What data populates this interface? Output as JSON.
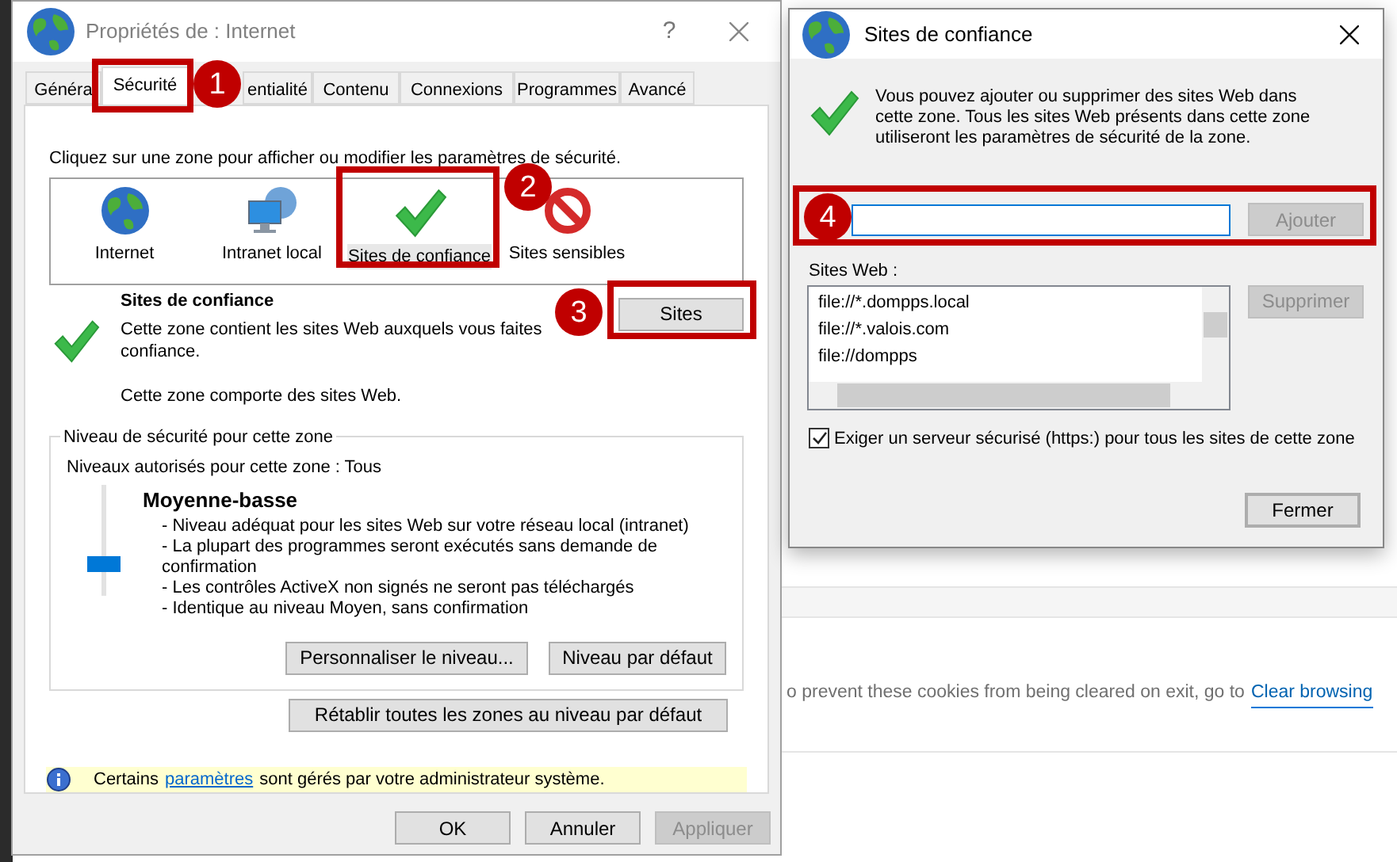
{
  "background_page": {
    "text": "o prevent these cookies from being cleared on exit, go to",
    "link": "Clear browsing"
  },
  "internet_properties": {
    "title": "Propriétés de : Internet",
    "help": "?",
    "tabs": [
      {
        "label": "Généra",
        "selected": false
      },
      {
        "label": "Sécurité",
        "selected": true
      },
      {
        "label": "entialité",
        "selected": false
      },
      {
        "label": "Contenu",
        "selected": false
      },
      {
        "label": "Connexions",
        "selected": false
      },
      {
        "label": "Programmes",
        "selected": false
      },
      {
        "label": "Avancé",
        "selected": false
      }
    ],
    "zone_prompt": "Cliquez sur une zone pour afficher ou modifier les paramètres de sécurité.",
    "zones": [
      {
        "label": "Internet",
        "kind": "globe",
        "selected": false
      },
      {
        "label": "Intranet local",
        "kind": "intranet",
        "selected": false
      },
      {
        "label": "Sites de confiance",
        "kind": "trusted",
        "selected": true
      },
      {
        "label": "Sites sensibles",
        "kind": "restricted",
        "selected": false
      }
    ],
    "zone_title": "Sites de confiance",
    "zone_description": "Cette zone contient les sites Web auxquels vous faites confiance.",
    "zone_note": "Cette zone comporte des sites Web.",
    "sites_button": "Sites",
    "security_group": {
      "legend": "Niveau de sécurité pour cette zone",
      "allowed_levels": "Niveaux autorisés pour cette zone : Tous",
      "level": 0.25,
      "level_name": "Moyenne-basse",
      "bullets": [
        "- Niveau adéquat pour les sites Web sur votre réseau local (intranet)",
        "- La plupart des programmes seront exécutés sans demande de confirmation",
        "- Les contrôles ActiveX non signés ne seront pas téléchargés",
        "- Identique au niveau Moyen, sans confirmation"
      ],
      "custom_button": "Personnaliser le niveau...",
      "default_button": "Niveau par défaut"
    },
    "reset_button": "Rétablir toutes les zones au niveau par défaut",
    "info": {
      "before": "Certains",
      "link": "paramètres",
      "after": "sont gérés par votre administrateur système."
    },
    "footer_buttons": [
      {
        "label": "OK",
        "disabled": false
      },
      {
        "label": "Annuler",
        "disabled": false
      },
      {
        "label": "Appliquer",
        "disabled": true
      }
    ]
  },
  "trusted_sites": {
    "title": "Sites de confiance",
    "description": "Vous pouvez ajouter ou supprimer des sites Web dans cette zone. Tous les sites Web présents dans cette zone utiliseront les paramètres de sécurité de la zone.",
    "add_button": {
      "label": "Ajouter",
      "disabled": true
    },
    "list_label": "Sites Web :",
    "sites": [
      "file://*.dompps.local",
      "file://*.valois.com",
      "file://dompps"
    ],
    "remove_button": {
      "label": "Supprimer",
      "disabled": true
    },
    "require_https": {
      "label": "Exiger un serveur sécurisé (https:) pour tous les sites de cette zone",
      "checked": true
    },
    "close_button": "Fermer"
  },
  "annotations": [
    {
      "number": "1"
    },
    {
      "number": "2"
    },
    {
      "number": "3"
    },
    {
      "number": "4"
    }
  ]
}
